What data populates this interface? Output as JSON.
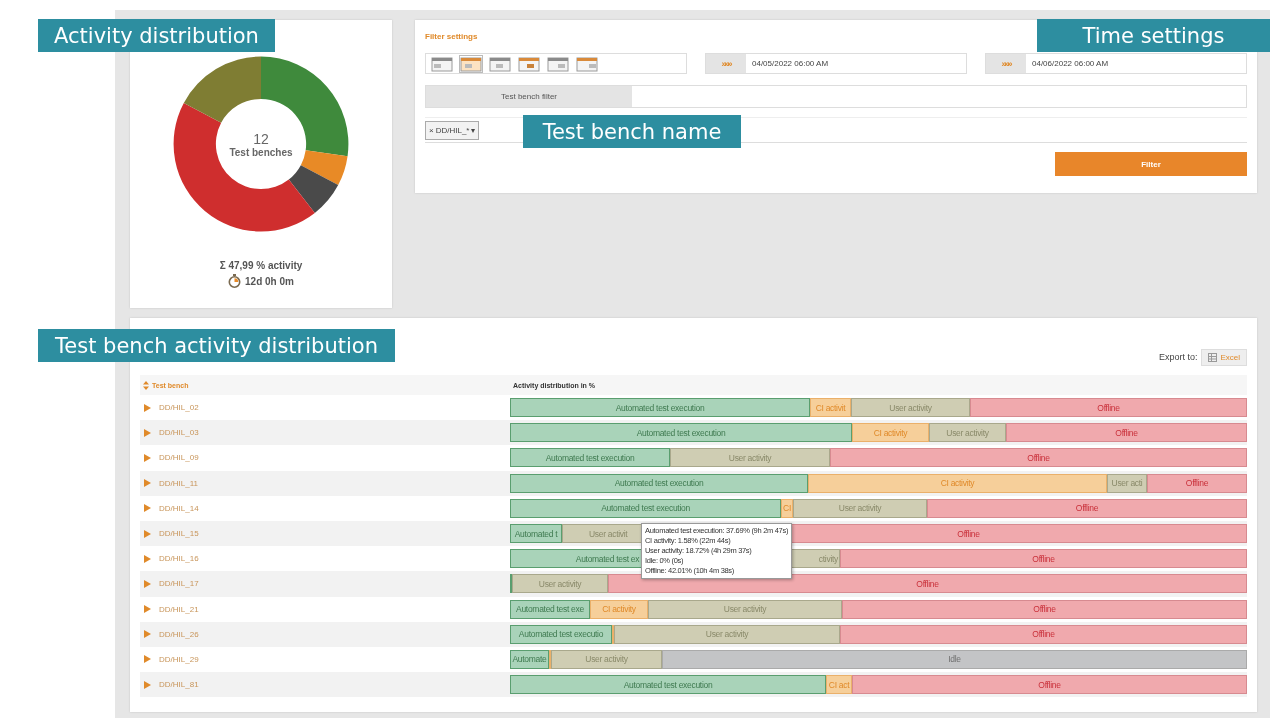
{
  "callouts": [
    {
      "label": "Activity distribution",
      "kind": "summary"
    },
    {
      "label": "Time settings",
      "kind": "time"
    },
    {
      "label": "Test bench name",
      "kind": "name"
    },
    {
      "label": "Test bench activity distribution",
      "kind": "table"
    }
  ],
  "summary": {
    "count": "12",
    "count_label": "Test benches",
    "activity": "Σ 47,99 % activity",
    "duration": "12d 0h 0m"
  },
  "filter": {
    "title": "Filter settings",
    "views": [
      {
        "selected": false
      },
      {
        "selected": true
      },
      {
        "selected": false
      },
      {
        "selected": false
      },
      {
        "selected": false
      },
      {
        "selected": false
      }
    ],
    "start": {
      "arrow": "»»»",
      "value": "04/05/2022 06:00 AM"
    },
    "end": {
      "arrow": "»»»",
      "value": "04/06/2022 06:00 AM"
    },
    "bench_filter_label": "Test bench filter",
    "tag": {
      "remove": "×",
      "label": "DD/HIL_*",
      "caret": "▾"
    },
    "button": "Filter"
  },
  "table": {
    "export_label": "Export to:",
    "export_button": "Excel",
    "columns": [
      "Test bench",
      "Activity distribution in %"
    ],
    "rows": [
      {
        "name": "DD/HIL_02",
        "segments": [
          {
            "kind": "auto",
            "label": "Automated test execution"
          },
          {
            "kind": "ci",
            "label": "CI activit"
          },
          {
            "kind": "user",
            "label": "User activity"
          },
          {
            "kind": "offline",
            "label": "Offline"
          }
        ]
      },
      {
        "name": "DD/HIL_03",
        "segments": [
          {
            "kind": "auto",
            "label": "Automated test execution"
          },
          {
            "kind": "ci",
            "label": "CI activity"
          },
          {
            "kind": "user",
            "label": "User activity"
          },
          {
            "kind": "offline",
            "label": "Offline"
          }
        ]
      },
      {
        "name": "DD/HIL_09",
        "segments": [
          {
            "kind": "auto",
            "label": "Automated test execution"
          },
          {
            "kind": "user",
            "label": "User activity"
          },
          {
            "kind": "offline",
            "label": "Offline"
          }
        ]
      },
      {
        "name": "DD/HIL_11",
        "segments": [
          {
            "kind": "auto",
            "label": "Automated test execution"
          },
          {
            "kind": "ci",
            "label": "CI activity"
          },
          {
            "kind": "user",
            "label": "User acti"
          },
          {
            "kind": "offline",
            "label": "Offline"
          }
        ]
      },
      {
        "name": "DD/HIL_14",
        "segments": [
          {
            "kind": "auto",
            "label": "Automated test execution"
          },
          {
            "kind": "ci",
            "label": "CI"
          },
          {
            "kind": "user",
            "label": "User activity"
          },
          {
            "kind": "offline",
            "label": "Offline"
          }
        ]
      },
      {
        "name": "DD/HIL_15",
        "segments": [
          {
            "kind": "auto",
            "label": "Automated t"
          },
          {
            "kind": "user",
            "label": "User activit"
          },
          {
            "kind": "offline",
            "label": "Offline"
          }
        ]
      },
      {
        "name": "DD/HIL_16",
        "segments": [
          {
            "kind": "auto",
            "label": "Automated test ex"
          },
          {
            "kind": "user",
            "label": "ctivity"
          },
          {
            "kind": "offline",
            "label": "Offline"
          }
        ]
      },
      {
        "name": "DD/HIL_17",
        "segments": [
          {
            "kind": "auto"
          },
          {
            "kind": "user",
            "label": "User activity"
          },
          {
            "kind": "offline",
            "label": "Offline"
          }
        ]
      },
      {
        "name": "DD/HIL_21",
        "segments": [
          {
            "kind": "auto",
            "label": "Automated test exe"
          },
          {
            "kind": "ci",
            "label": "CI activity"
          },
          {
            "kind": "user",
            "label": "User activity"
          },
          {
            "kind": "offline",
            "label": "Offline"
          }
        ]
      },
      {
        "name": "DD/HIL_26",
        "segments": [
          {
            "kind": "auto",
            "label": "Automated test executio"
          },
          {
            "kind": "ci"
          },
          {
            "kind": "user",
            "label": "User activity"
          },
          {
            "kind": "offline",
            "label": "Offline"
          }
        ]
      },
      {
        "name": "DD/HIL_29",
        "segments": [
          {
            "kind": "auto",
            "label": "Automate"
          },
          {
            "kind": "ci"
          },
          {
            "kind": "user",
            "label": "User activity"
          },
          {
            "kind": "idle",
            "label": "Idle"
          }
        ]
      },
      {
        "name": "DD/HIL_81",
        "segments": [
          {
            "kind": "auto",
            "label": "Automated test execution"
          },
          {
            "kind": "ci",
            "label": "CI act"
          },
          {
            "kind": "offline",
            "label": "Offline"
          }
        ]
      }
    ],
    "tooltip": [
      "Automated test execution: 37.69% (9h 2m 47s)",
      "CI activity: 1.58% (22m 44s)",
      "User activity: 18.72% (4h 29m 37s)",
      "Idle: 0% (0s)",
      "Offline: 42.01% (10h 4m 38s)"
    ]
  }
}
